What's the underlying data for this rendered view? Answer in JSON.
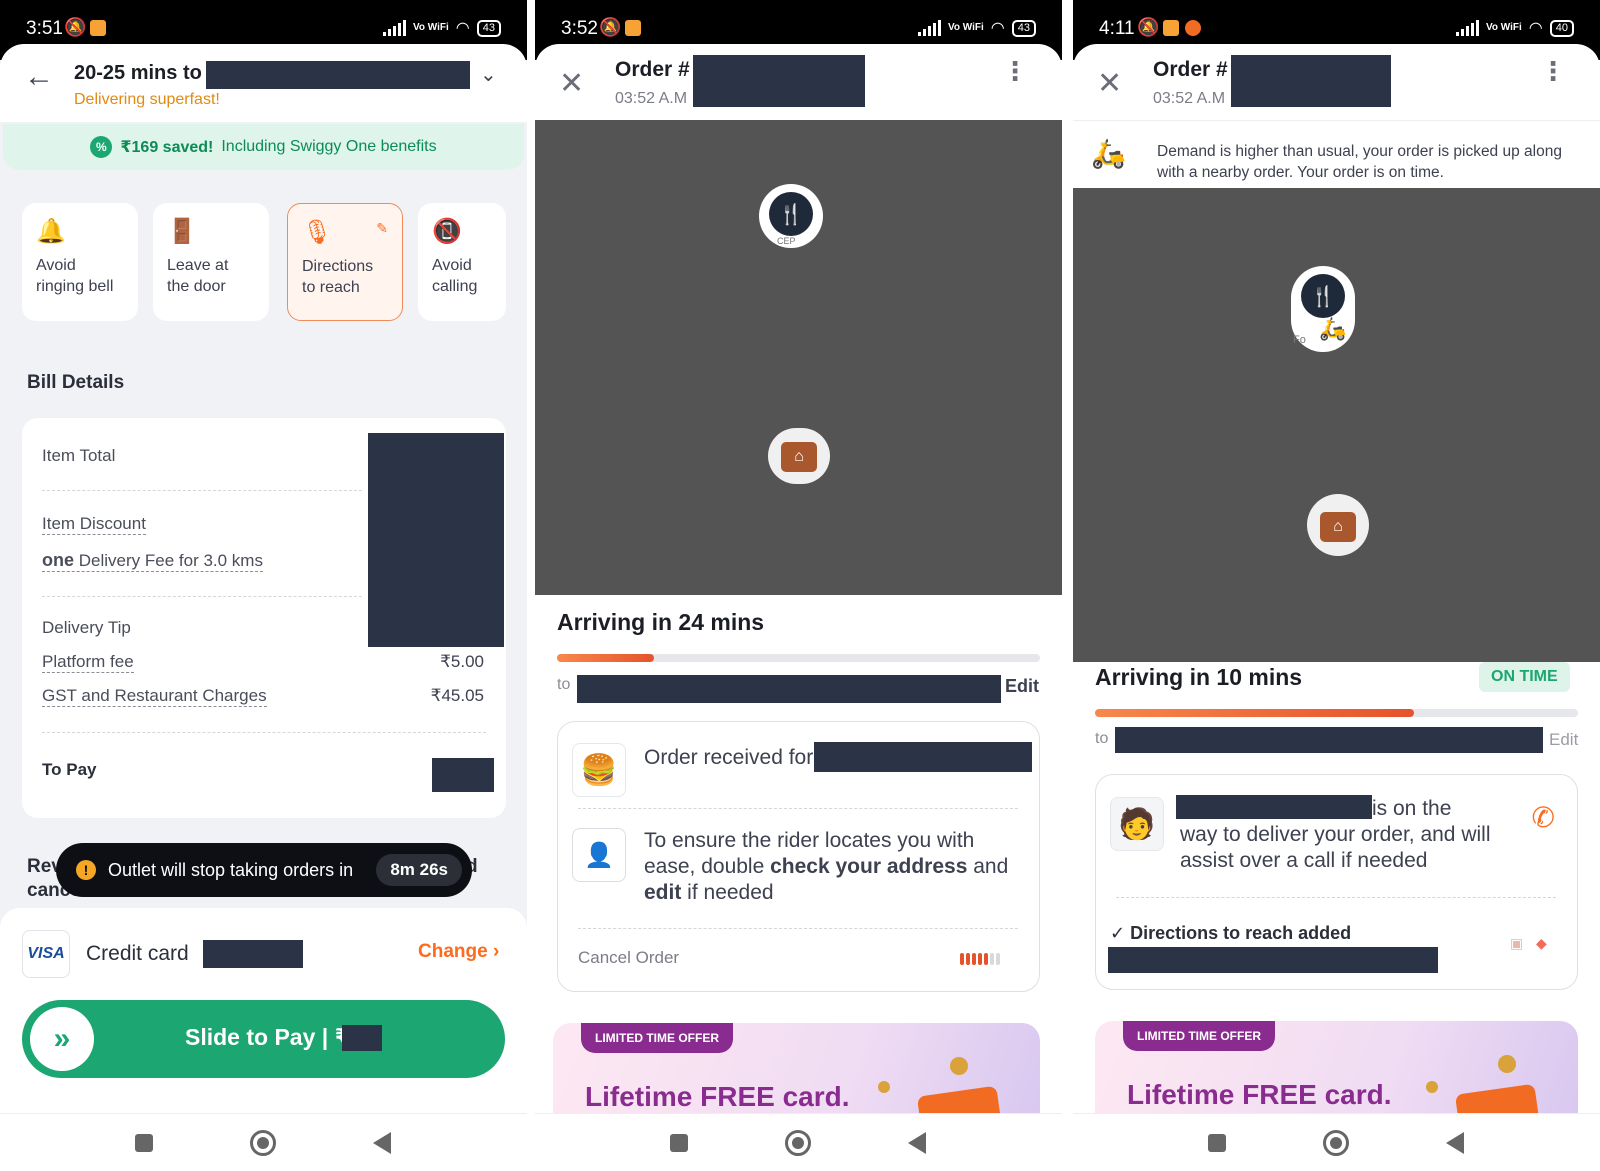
{
  "screen1": {
    "status": {
      "time": "3:51",
      "battery": "43",
      "vowifi": "Vo WiFi"
    },
    "header": {
      "title": "20-25 mins to",
      "subtitle": "Delivering superfast!"
    },
    "savings": {
      "amount": "₹169 saved!",
      "text": "Including Swiggy One benefits"
    },
    "instructions": [
      {
        "label": "Avoid ringing bell",
        "icon": "bell-icon"
      },
      {
        "label": "Leave at the door",
        "icon": "door-icon"
      },
      {
        "label": "Directions to reach",
        "icon": "microphone-icon"
      },
      {
        "label": "Avoid calling",
        "icon": "phone-off-icon"
      }
    ],
    "bill": {
      "heading": "Bill Details",
      "item_total": "Item Total",
      "item_discount": "Item Discount",
      "one_badge": "one",
      "delivery_fee": "Delivery Fee for 3.0 kms",
      "delivery_tip": "Delivery Tip",
      "platform_fee": "Platform fee",
      "platform_fee_value": "₹5.00",
      "gst": "GST and Restaurant Charges",
      "gst_value": "₹45.05",
      "to_pay": "To Pay"
    },
    "behind_toast": {
      "left": "Rev",
      "line2": "cancellations",
      "right": "d"
    },
    "toast": {
      "text": "Outlet will stop taking orders in",
      "timer": "8m 26s"
    },
    "payment": {
      "card_brand": "VISA",
      "method": "Credit card",
      "change": "Change",
      "slide": "Slide to Pay | ₹"
    }
  },
  "screen2": {
    "status": {
      "time": "3:52",
      "battery": "43",
      "vowifi": "Vo WiFi"
    },
    "header": {
      "order": "Order #",
      "time": "03:52 A.M"
    },
    "restaurant_label": "CEP",
    "arriving": "Arriving in 24 mins",
    "progress": 0.2,
    "to": "to",
    "edit": "Edit",
    "order_received": "Order received for",
    "rider_note_a": "To ensure the rider locates you with ease, double ",
    "rider_note_b": "check your address",
    "rider_note_c": " and ",
    "rider_note_d": "edit",
    "rider_note_e": " if needed",
    "cancel": "Cancel Order",
    "offer": {
      "tag": "LIMITED TIME OFFER",
      "headline": "Lifetime FREE card."
    }
  },
  "screen3": {
    "status": {
      "time": "4:11",
      "battery": "40",
      "vowifi": "Vo WiFi"
    },
    "header": {
      "order": "Order #",
      "time": "03:52 A.M"
    },
    "notice": "Demand is higher than usual, your order is picked up along with a nearby order. Your order is on time.",
    "restaurant_label": "Fo",
    "arriving": "Arriving in 10 mins",
    "on_time": "ON TIME",
    "progress": 0.66,
    "to": "to",
    "edit": "Edit",
    "rider_a": "is on the",
    "rider_b": "way to deliver your order, and will assist over a call if needed",
    "directions": "✓ Directions to reach added",
    "offer": {
      "tag": "LIMITED TIME OFFER",
      "headline": "Lifetime FREE card."
    }
  },
  "colors": {
    "swiggy_orange": "#fc6b1e",
    "green": "#1ba672",
    "navy_redaction": "#2b3446",
    "map_grey": "#545454"
  }
}
